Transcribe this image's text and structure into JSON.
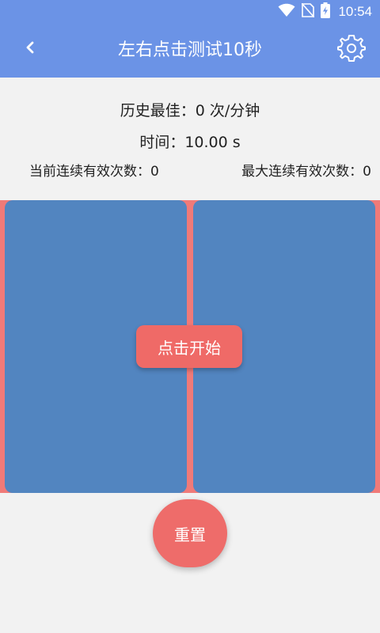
{
  "status_bar": {
    "time": "10:54",
    "icons": [
      "wifi-icon",
      "no-sim-icon",
      "battery-charging-icon"
    ]
  },
  "app_bar": {
    "back_icon": "chevron-left-icon",
    "title": "左右点击测试10秒",
    "settings_icon": "gear-icon"
  },
  "stats": {
    "best_label": "历史最佳：",
    "best_value": "0 次/分钟",
    "time_label": "时间：",
    "time_value": "10.00 s",
    "current_streak_label": "当前连续有效次数：",
    "current_streak_value": "0",
    "max_streak_label": "最大连续有效次数：",
    "max_streak_value": "0"
  },
  "tap_area": {
    "start_label": "点击开始"
  },
  "reset_label": "重置",
  "colors": {
    "primary": "#6b93e6",
    "panel_blue": "#5285c0",
    "accent_red": "#ef6a67",
    "area_background": "#f07a78"
  }
}
